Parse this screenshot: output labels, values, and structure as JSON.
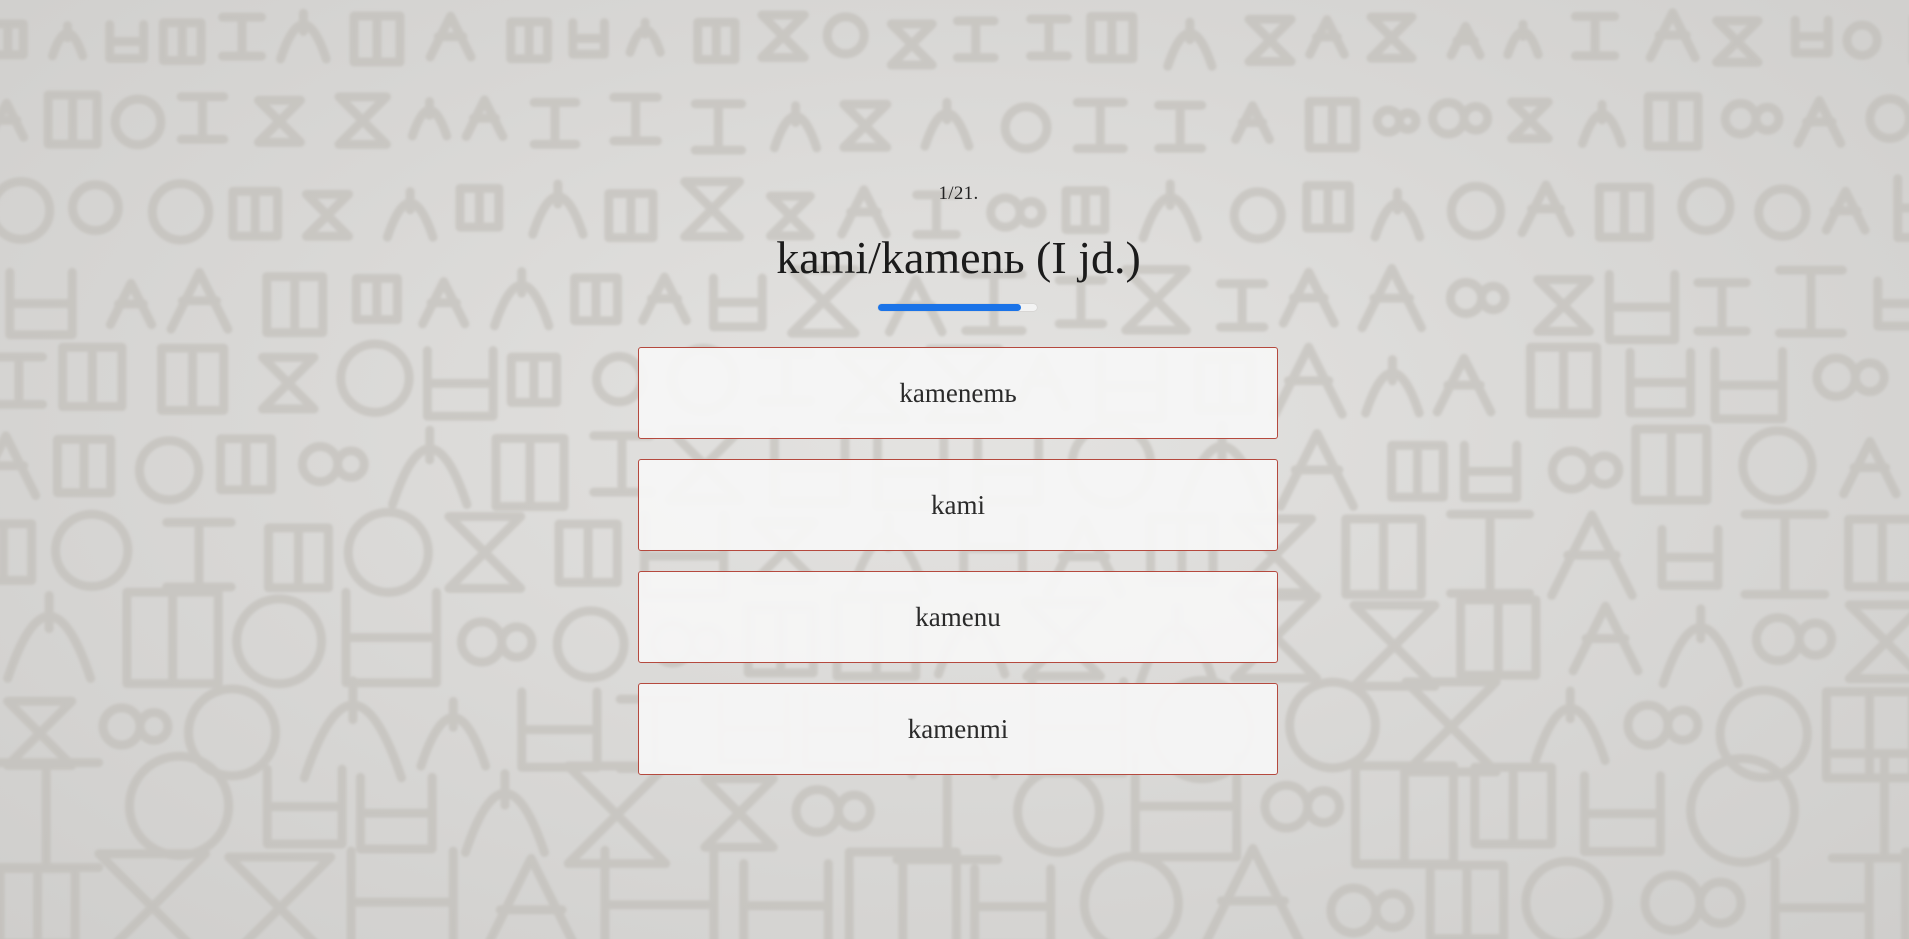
{
  "quiz": {
    "counter": "1/21.",
    "word": "kami/kamenь (I jd.)",
    "progress": 0.9,
    "progress_color": "#1a73e8",
    "answers": [
      "kamenemь",
      "kami",
      "kamenu",
      "kamenmi"
    ],
    "answer_border_color": "#b5493e"
  },
  "background": {
    "description_icon": "glagolitic-stone-texture"
  }
}
